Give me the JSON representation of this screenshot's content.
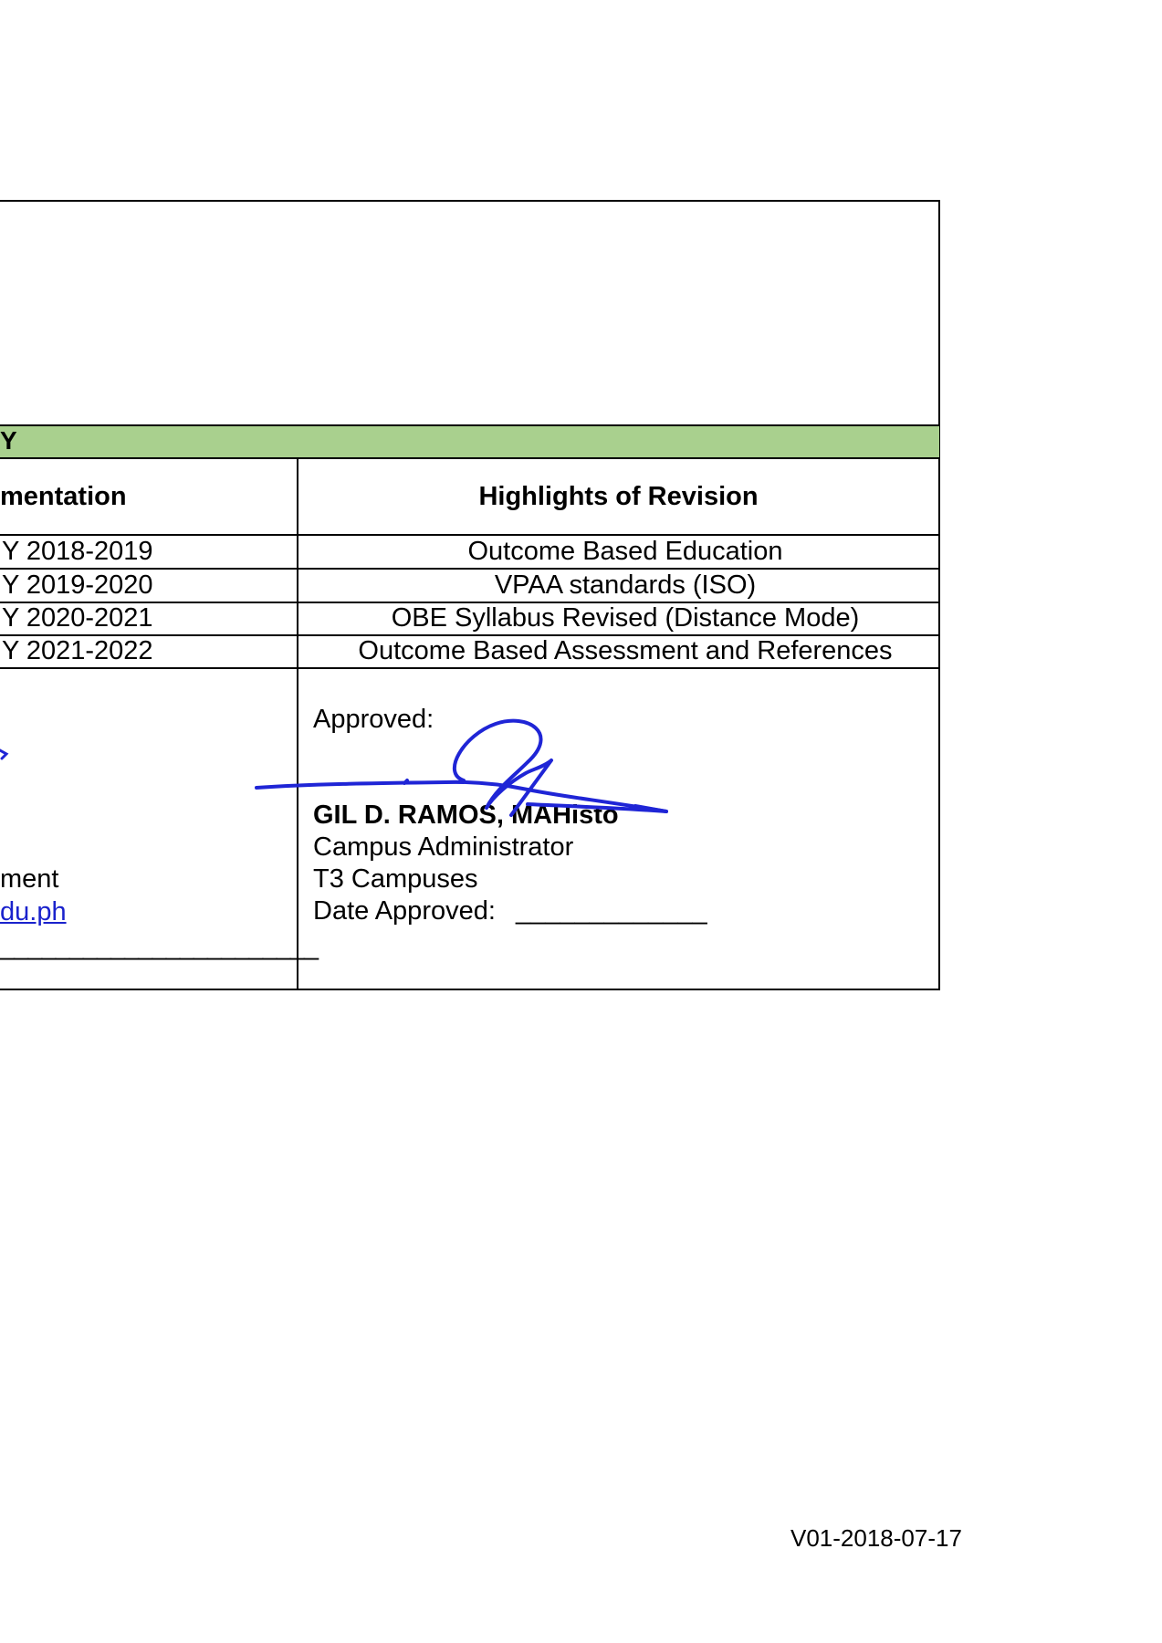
{
  "section_header": {
    "label": "Y",
    "band_color": "#a9d08e"
  },
  "table": {
    "col_left_header": "mentation",
    "col_right_header": "Highlights of Revision",
    "rows": [
      {
        "left": "Y 2018-2019",
        "right": "Outcome Based Education"
      },
      {
        "left": "Y 2019-2020",
        "right": "VPAA standards (ISO)"
      },
      {
        "left": "Y 2020-2021",
        "right": "OBE Syllabus Revised (Distance Mode)"
      },
      {
        "left": "Y 2021-2022",
        "right": "Outcome Based Assessment and References"
      }
    ]
  },
  "signatory_left": {
    "role_fragment": "ment",
    "email_fragment": "du.ph",
    "date_blank": "_______________________"
  },
  "approval": {
    "label": "Approved:",
    "name": "GIL D. RAMOS, MAHisto",
    "title": "Campus Administrator",
    "campus": "T3 Campuses",
    "date_label": "Date Approved:",
    "date_blank": "_____________"
  },
  "signature": {
    "ink_color": "#1f25d6"
  },
  "footer": {
    "version_code": "V01-2018-07-17"
  }
}
